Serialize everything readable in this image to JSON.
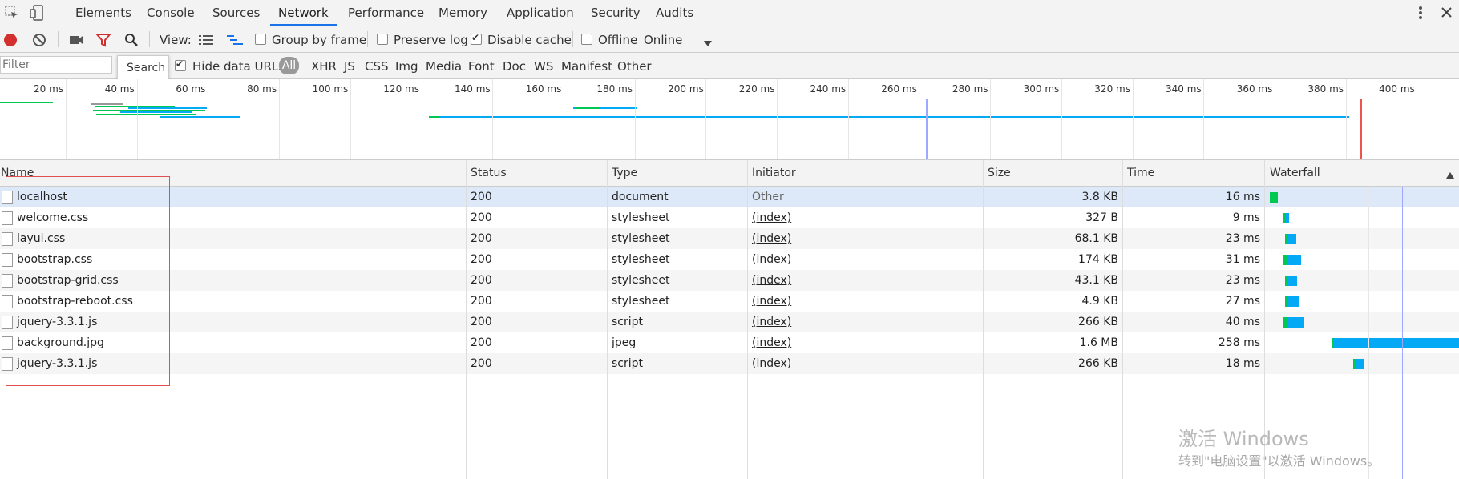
{
  "tabs": [
    "Elements",
    "Console",
    "Sources",
    "Network",
    "Performance",
    "Memory",
    "Application",
    "Security",
    "Audits"
  ],
  "active_tab": "Network",
  "toolbar": {
    "view_label": "View:",
    "group_by_frame": "Group by frame",
    "preserve_log": "Preserve log",
    "disable_cache": "Disable cache",
    "offline": "Offline",
    "throttle": "Online"
  },
  "filterbar": {
    "placeholder": "Filter",
    "search_tooltip": "Search",
    "hide_data_urls": "Hide data URLs",
    "types": [
      "All",
      "XHR",
      "JS",
      "CSS",
      "Img",
      "Media",
      "Font",
      "Doc",
      "WS",
      "Manifest",
      "Other"
    ]
  },
  "overview_ticks": [
    "20 ms",
    "40 ms",
    "60 ms",
    "80 ms",
    "100 ms",
    "120 ms",
    "140 ms",
    "160 ms",
    "180 ms",
    "200 ms",
    "220 ms",
    "240 ms",
    "260 ms",
    "280 ms",
    "300 ms",
    "320 ms",
    "340 ms",
    "360 ms",
    "380 ms",
    "400 ms",
    "4"
  ],
  "columns": {
    "name": "Name",
    "status": "Status",
    "type": "Type",
    "initiator": "Initiator",
    "size": "Size",
    "time": "Time",
    "waterfall": "Waterfall"
  },
  "requests": [
    {
      "name": "localhost",
      "status": "200",
      "type": "document",
      "initiator": "Other",
      "size": "3.8 KB",
      "time": "16 ms"
    },
    {
      "name": "welcome.css",
      "status": "200",
      "type": "stylesheet",
      "initiator": "(index)",
      "size": "327 B",
      "time": "9 ms"
    },
    {
      "name": "layui.css",
      "status": "200",
      "type": "stylesheet",
      "initiator": "(index)",
      "size": "68.1 KB",
      "time": "23 ms"
    },
    {
      "name": "bootstrap.css",
      "status": "200",
      "type": "stylesheet",
      "initiator": "(index)",
      "size": "174 KB",
      "time": "31 ms"
    },
    {
      "name": "bootstrap-grid.css",
      "status": "200",
      "type": "stylesheet",
      "initiator": "(index)",
      "size": "43.1 KB",
      "time": "23 ms"
    },
    {
      "name": "bootstrap-reboot.css",
      "status": "200",
      "type": "stylesheet",
      "initiator": "(index)",
      "size": "4.9 KB",
      "time": "27 ms"
    },
    {
      "name": "jquery-3.3.1.js",
      "status": "200",
      "type": "script",
      "initiator": "(index)",
      "size": "266 KB",
      "time": "40 ms"
    },
    {
      "name": "background.jpg",
      "status": "200",
      "type": "jpeg",
      "initiator": "(index)",
      "size": "1.6 MB",
      "time": "258 ms"
    },
    {
      "name": "jquery-3.3.1.js",
      "status": "200",
      "type": "script",
      "initiator": "(index)",
      "size": "266 KB",
      "time": "18 ms"
    }
  ],
  "watermark": {
    "line1": "激活 Windows",
    "line2": "转到\"电脑设置\"以激活 Windows。"
  },
  "colors": {
    "waiting": "#00c853",
    "download": "#03a9f4",
    "record": "#d32f2f",
    "filter_active": "#d32f2f"
  }
}
